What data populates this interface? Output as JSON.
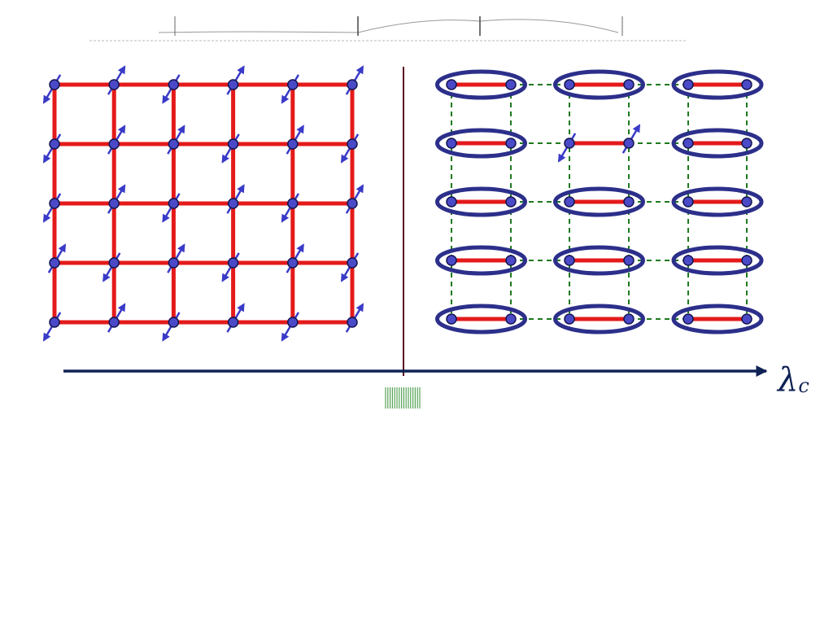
{
  "colors": {
    "background": "#ffffff",
    "strong_bond": "#e41a1a",
    "weak_bond": "#1e7a1e",
    "site_fill": "#4a4ac8",
    "site_stroke": "#141450",
    "spin_arrow": "#3a3ac8",
    "dimer_ring": "#2c2f8a",
    "axis": "#0f2255",
    "divider": "#5a1020",
    "critical_tag": "#2e8b2e",
    "faint_text": "#999999"
  },
  "left_phase": {
    "description_name": "neel-ordered-lattice",
    "rows": 5,
    "cols": 6,
    "spin_orientations": [
      [
        "down-left",
        "up-right",
        "down-left",
        "up-right",
        "down-left",
        "up-right"
      ],
      [
        "down-left",
        "up-right",
        "up-right",
        "down-left",
        "up-right",
        "down-left"
      ],
      [
        "down-left",
        "up-right",
        "down-left",
        "up-right",
        "down-left",
        "up-right"
      ],
      [
        "up-right",
        "down-left",
        "up-right",
        "down-left",
        "up-right",
        "down-left"
      ],
      [
        "down-left",
        "up-right",
        "down-left",
        "up-right",
        "down-left",
        "up-right"
      ]
    ]
  },
  "right_phase": {
    "description_name": "dimerized-lattice",
    "rows": 5,
    "dimer_columns": 3,
    "broken_dimer": {
      "row": 1,
      "col": 1
    },
    "broken_dimer_spins": [
      "down-left",
      "up-right"
    ]
  },
  "axis": {
    "label": "λ",
    "label_subscript": "c"
  },
  "critical_point_tag": {
    "text": ""
  },
  "header_strip": {
    "text": ""
  }
}
